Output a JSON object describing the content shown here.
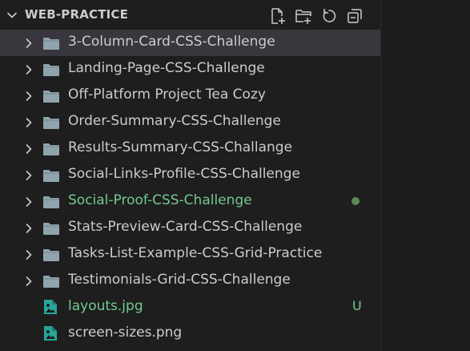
{
  "explorer": {
    "section_title": "WEB-PRACTICE",
    "actions": [
      {
        "name": "new-file-icon",
        "tooltip": "New File"
      },
      {
        "name": "new-folder-icon",
        "tooltip": "New Folder"
      },
      {
        "name": "refresh-icon",
        "tooltip": "Refresh Explorer"
      },
      {
        "name": "collapse-all-icon",
        "tooltip": "Collapse Folders in Explorer"
      }
    ],
    "items": [
      {
        "label": "3-Column-Card-CSS-Challenge",
        "kind": "folder",
        "selected": true
      },
      {
        "label": "Landing-Page-CSS-Challenge",
        "kind": "folder"
      },
      {
        "label": "Off-Platform Project Tea Cozy",
        "kind": "folder"
      },
      {
        "label": "Order-Summary-CSS-Challenge",
        "kind": "folder"
      },
      {
        "label": "Results-Summary-CSS-Challange",
        "kind": "folder"
      },
      {
        "label": "Social-Links-Profile-CSS-Challenge",
        "kind": "folder"
      },
      {
        "label": "Social-Proof-CSS-Challenge",
        "kind": "folder",
        "status": "modified-dot"
      },
      {
        "label": "Stats-Preview-Card-CSS-Challenge",
        "kind": "folder"
      },
      {
        "label": "Tasks-List-Example-CSS-Grid-Practice",
        "kind": "folder"
      },
      {
        "label": "Testimonials-Grid-CSS-Challenge",
        "kind": "folder"
      },
      {
        "label": "layouts.jpg",
        "kind": "image",
        "badge": "U"
      },
      {
        "label": "screen-sizes.png",
        "kind": "image"
      }
    ],
    "colors": {
      "background": "#1e1e1e",
      "selected_row": "#37373d",
      "text": "#cccccc",
      "untracked_green": "#73c991",
      "folder_icon": "#90a4ae",
      "image_icon": "#26a69a"
    }
  }
}
